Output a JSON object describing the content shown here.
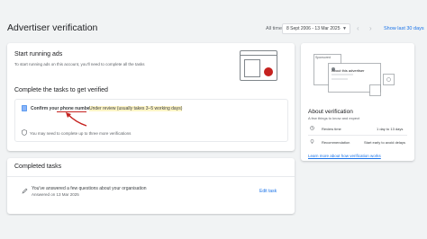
{
  "header": {
    "title": "Advertiser verification",
    "date_label": "All time",
    "date_range": "8 Sept 2006 - 13 Mar 2025",
    "show_last": "Show last 30 days"
  },
  "start": {
    "title": "Start running ads",
    "desc": "To start running ads on this account, you'll need to complete all the tasks"
  },
  "tasks": {
    "title": "Complete the tasks to get verified",
    "phone_label": "Confirm your phone number",
    "phone_status": "Under review (usually takes 3–5 working days)",
    "more_note": "You may need to complete up to three more verifications"
  },
  "completed": {
    "title": "Completed tasks",
    "task_label": "You've answered a few questions about your organisation",
    "task_date": "Answered on 13 Mar 2025",
    "edit_label": "Edit task"
  },
  "side": {
    "illus_tag": "Sponsored",
    "illus_heading": "About this advertiser",
    "title": "About verification",
    "subtitle": "A few things to know and expect",
    "rows": [
      {
        "label": "Review time",
        "value": "1 day to 13 days"
      },
      {
        "label": "Recommendation",
        "value": "Start early to avoid delays"
      }
    ],
    "learn_more": "Learn more about how verification works"
  }
}
